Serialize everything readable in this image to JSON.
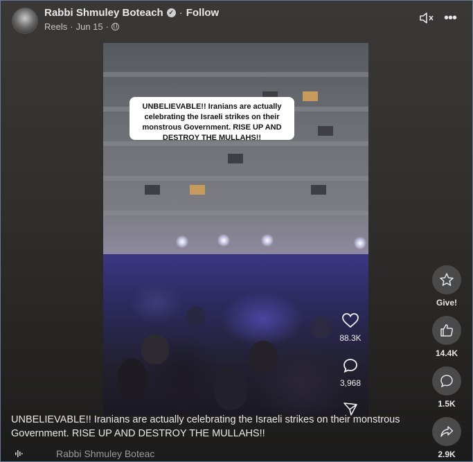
{
  "header": {
    "author_name": "Rabbi Shmuley Boteach",
    "verified_symbol": "✓",
    "separator": "·",
    "follow_label": "Follow",
    "meta_source": "Reels",
    "meta_date": "Jun 15",
    "meta_separator": "·",
    "icons": [
      "avatar",
      "verified-badge-icon",
      "globe-icon",
      "mute-icon",
      "more-options-icon"
    ]
  },
  "video": {
    "overlay_text": "UNBELIEVABLE!! Iranians are actually celebrating the Israeli strikes on their monstrous Government. RISE UP AND DESTROY THE MULLAHS!!",
    "like_count": "88.3K",
    "comment_count": "3,968"
  },
  "actions": {
    "give_label": "Give!",
    "likes_label": "14.4K",
    "comments_label": "1.5K",
    "shares_label": "2.9K"
  },
  "post": {
    "caption": "UNBELIEVABLE!! Iranians are actually celebrating the Israeli strikes on their monstrous Government. RISE UP AND DESTROY THE MULLAHS!!"
  },
  "footer": {
    "author_truncated": "Rabbi Shmuley Boteac"
  },
  "colors": {
    "background": "#2b2b2b",
    "text": "#e9e9e9",
    "caption_box": "#ffffff",
    "crowd_purple": "#3a3782"
  }
}
